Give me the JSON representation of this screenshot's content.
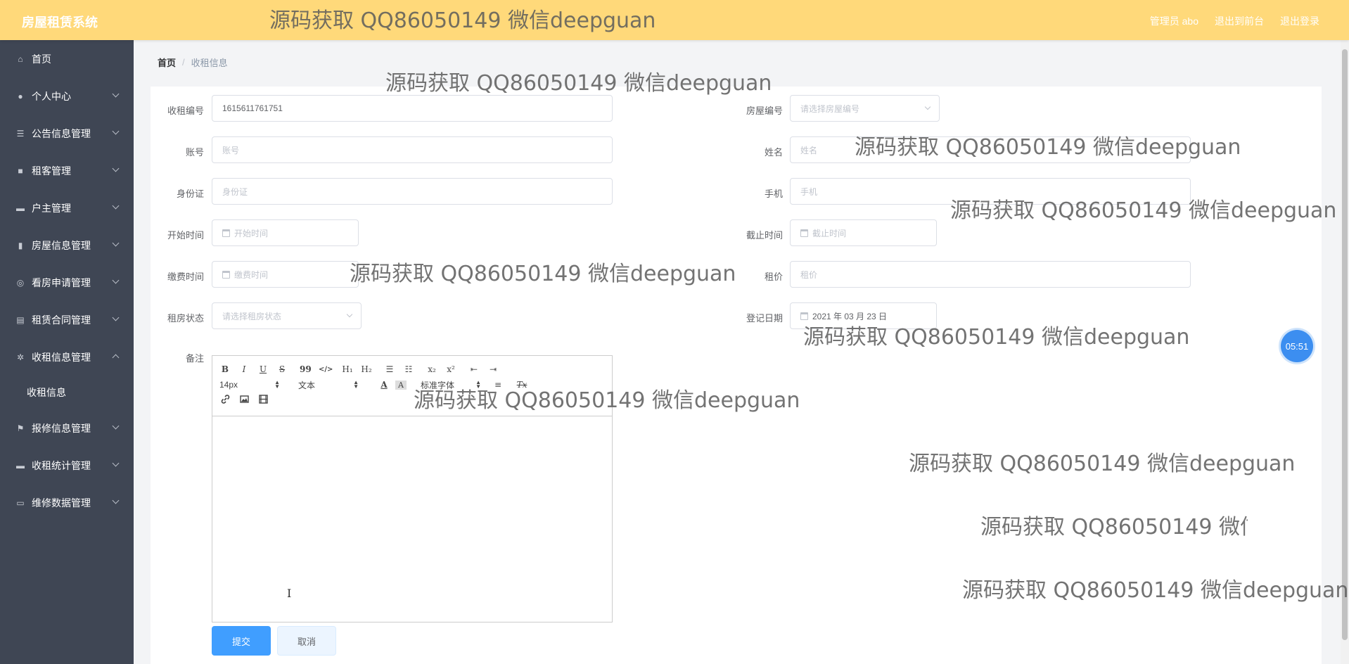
{
  "header": {
    "brand": "房屋租赁系统",
    "nav": [
      "管理员 abo",
      "退出到前台",
      "退出登录"
    ]
  },
  "sidebar": {
    "items": [
      {
        "label": "首页",
        "icon": "home-icon",
        "has_children": false
      },
      {
        "label": "个人中心",
        "icon": "user-icon",
        "has_children": true
      },
      {
        "label": "公告信息管理",
        "icon": "list-icon",
        "has_children": true
      },
      {
        "label": "租客管理",
        "icon": "camera-icon",
        "has_children": true
      },
      {
        "label": "户主管理",
        "icon": "monitor-icon",
        "has_children": true
      },
      {
        "label": "房屋信息管理",
        "icon": "bar-chart-icon",
        "has_children": true
      },
      {
        "label": "看房申请管理",
        "icon": "compass-icon",
        "has_children": true
      },
      {
        "label": "租赁合同管理",
        "icon": "clipboard-icon",
        "has_children": true
      },
      {
        "label": "收租信息管理",
        "icon": "settings-icon",
        "has_children": true,
        "expanded": true,
        "children": [
          "收租信息"
        ]
      },
      {
        "label": "报修信息管理",
        "icon": "flag-icon",
        "has_children": true
      },
      {
        "label": "收租统计管理",
        "icon": "monitor-icon",
        "has_children": true
      },
      {
        "label": "维修数据管理",
        "icon": "chat-icon",
        "has_children": true
      }
    ]
  },
  "breadcrumb": {
    "home": "首页",
    "separator": "/",
    "current": "收租信息"
  },
  "form": {
    "rent_no": {
      "label": "收租编号",
      "value": "1615611761751"
    },
    "house_no": {
      "label": "房屋编号",
      "placeholder": "请选择房屋编号"
    },
    "account": {
      "label": "账号",
      "placeholder": "账号"
    },
    "name": {
      "label": "姓名",
      "placeholder": "姓名"
    },
    "id_card": {
      "label": "身份证",
      "placeholder": "身份证"
    },
    "phone": {
      "label": "手机",
      "placeholder": "手机"
    },
    "start_time": {
      "label": "开始时间",
      "placeholder": "开始时间"
    },
    "end_time": {
      "label": "截止时间",
      "placeholder": "截止时间"
    },
    "pay_time": {
      "label": "缴费时间",
      "placeholder": "缴费时间"
    },
    "rent_price": {
      "label": "租价",
      "placeholder": "租价"
    },
    "rent_status": {
      "label": "租房状态",
      "placeholder": "请选择租房状态"
    },
    "register_date": {
      "label": "登记日期",
      "value": "2021 年 03 月 23 日"
    },
    "remark": {
      "label": "备注"
    }
  },
  "editor": {
    "font_size": "14px",
    "block_type": "文本",
    "font_family": "标准字体",
    "row1_buttons": [
      "B",
      "I",
      "U",
      "S",
      "99",
      "</>",
      "H₁",
      "H₂",
      "☰",
      "☷",
      "x₂",
      "x²",
      "⇤",
      "⇥"
    ],
    "row2_glyphs": [
      "A",
      "A",
      "≡",
      "Tx"
    ],
    "row3_buttons": [
      "link",
      "image",
      "video"
    ]
  },
  "buttons": {
    "submit": "提交",
    "cancel": "取消"
  },
  "timer": "05:51",
  "watermark": "源码获取 QQ86050149 微信deepguan",
  "colors": {
    "topbar": "#ffd97a",
    "sidebar": "#3f4654",
    "primary": "#409eff"
  }
}
